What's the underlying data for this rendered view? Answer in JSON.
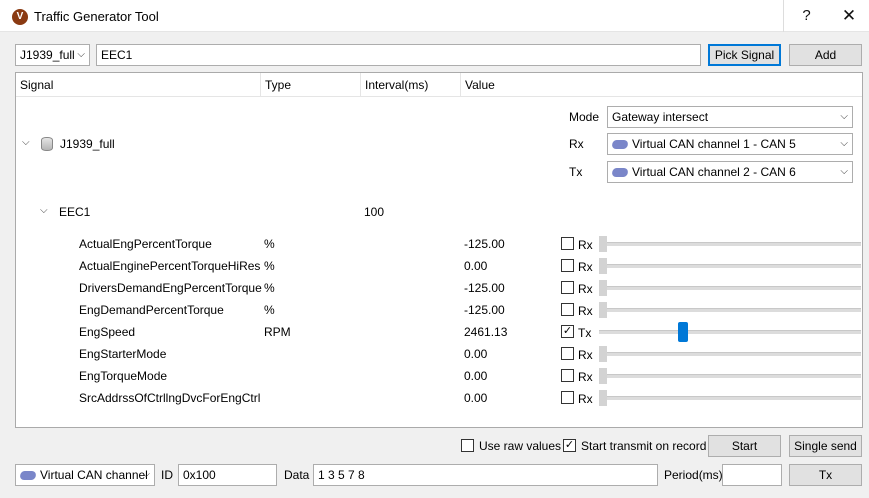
{
  "window": {
    "title": "Traffic Generator Tool",
    "app_icon": "V",
    "help_label": "?",
    "close_label": "✕"
  },
  "toolbar": {
    "database_selected": "J1939_full",
    "message_value": "EEC1",
    "pick_signal_label": "Pick Signal",
    "add_label": "Add"
  },
  "columns": [
    "Signal",
    "Type",
    "Interval(ms)",
    "Value"
  ],
  "database_node": {
    "label": "J1939_full"
  },
  "gateway": {
    "mode_label": "Mode",
    "mode_value": "Gateway intersect",
    "rx_label": "Rx",
    "rx_value": "Virtual CAN channel 1 - CAN 5",
    "tx_label": "Tx",
    "tx_value": "Virtual CAN channel 2 - CAN 6"
  },
  "message_node": {
    "label": "EEC1",
    "interval": "100"
  },
  "signals": [
    {
      "name": "ActualEngPercentTorque",
      "type": "%",
      "value": "-125.00",
      "checked": false,
      "dir": "Rx",
      "slider": 0.0
    },
    {
      "name": "ActualEnginePercentTorqueHiRes",
      "type": "%",
      "value": "0.00",
      "checked": false,
      "dir": "Rx",
      "slider": 0.0
    },
    {
      "name": "DriversDemandEngPercentTorque",
      "type": "%",
      "value": "-125.00",
      "checked": false,
      "dir": "Rx",
      "slider": 0.0
    },
    {
      "name": "EngDemandPercentTorque",
      "type": "%",
      "value": "-125.00",
      "checked": false,
      "dir": "Rx",
      "slider": 0.0
    },
    {
      "name": "EngSpeed",
      "type": "RPM",
      "value": "2461.13",
      "checked": true,
      "dir": "Tx",
      "slider": 0.3
    },
    {
      "name": "EngStarterMode",
      "type": "",
      "value": "0.00",
      "checked": false,
      "dir": "Rx",
      "slider": 0.0
    },
    {
      "name": "EngTorqueMode",
      "type": "",
      "value": "0.00",
      "checked": false,
      "dir": "Rx",
      "slider": 0.0
    },
    {
      "name": "SrcAddrssOfCtrllngDvcForEngCtrl",
      "type": "",
      "value": "0.00",
      "checked": false,
      "dir": "Rx",
      "slider": 0.0
    }
  ],
  "options": {
    "use_raw_label": "Use raw values",
    "use_raw_checked": false,
    "start_on_record_label": "Start transmit on record",
    "start_on_record_checked": true,
    "start_label": "Start",
    "single_send_label": "Single send"
  },
  "bottom": {
    "channel_value": "Virtual CAN channel",
    "id_label": "ID",
    "id_value": "0x100",
    "data_label": "Data",
    "data_value": "1 3 5 7 8",
    "period_label": "Period(ms)",
    "period_value": "",
    "tx_button_label": "Tx"
  },
  "colors": {
    "accent": "#0078d7",
    "app_icon": "#8a3a12"
  }
}
